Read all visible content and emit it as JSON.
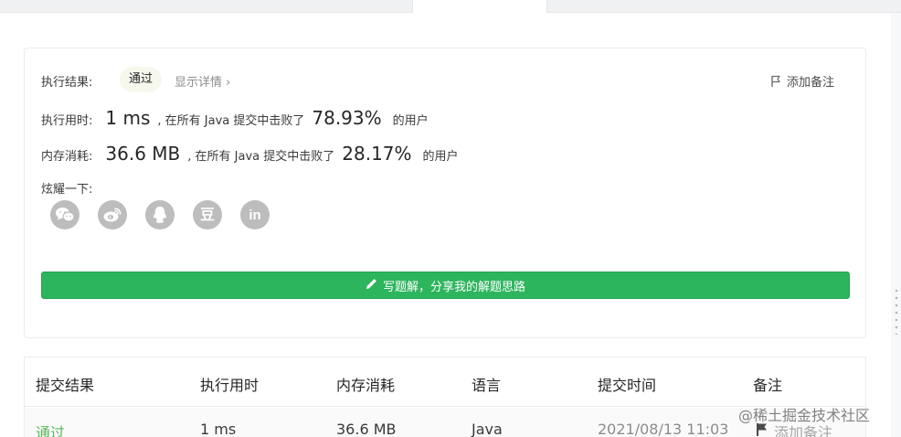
{
  "result": {
    "status_label": "执行结果:",
    "status_value": "通过",
    "details_link": "显示详情 ›",
    "add_note": "添加备注",
    "runtime": {
      "label": "执行用时:",
      "value": "1 ms",
      "middle": ", 在所有 Java 提交中击败了",
      "percent": "78.93%",
      "tail": "的用户"
    },
    "memory": {
      "label": "内存消耗:",
      "value": "36.6 MB",
      "middle": ", 在所有 Java 提交中击败了",
      "percent": "28.17%",
      "tail": "的用户"
    },
    "share_label": "炫耀一下:",
    "share_icons": [
      "wechat-icon",
      "weibo-icon",
      "qq-icon",
      "douban-icon",
      "linkedin-icon"
    ],
    "douban_glyph": "豆",
    "linkedin_glyph": "in",
    "write_solution": "写题解，分享我的解题思路"
  },
  "history": {
    "columns": [
      "提交结果",
      "执行用时",
      "内存消耗",
      "语言",
      "提交时间",
      "备注"
    ],
    "rows": [
      {
        "result": "通过",
        "runtime": "1 ms",
        "memory": "36.6 MB",
        "language": "Java",
        "submitted_at": "2021/08/13 11:03",
        "note": "添加备注"
      }
    ]
  },
  "watermark": "@稀土掘金技术社区",
  "colors": {
    "accent_green": "#2db55d",
    "pass_green": "#5cb85c",
    "icon_gray": "#bdbdbd"
  }
}
